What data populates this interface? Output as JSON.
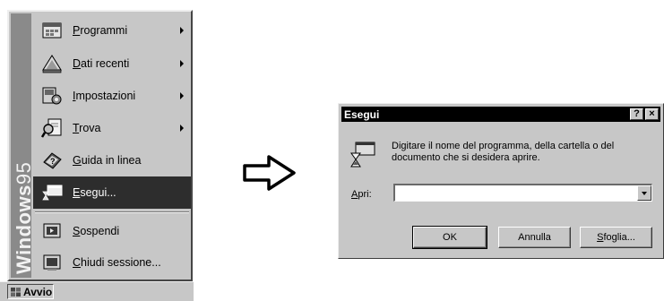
{
  "start_menu": {
    "brand": {
      "bold": "Windows",
      "light": "95"
    },
    "items": [
      {
        "label": "Programmi",
        "accel": "P",
        "rest": "rogrammi",
        "submenu": true,
        "icon": "programs-icon"
      },
      {
        "label": "Dati recenti",
        "accel": "D",
        "rest": "ati recenti",
        "submenu": true,
        "icon": "documents-icon"
      },
      {
        "label": "Impostazioni",
        "accel": "I",
        "rest": "mpostazioni",
        "submenu": true,
        "icon": "settings-icon"
      },
      {
        "label": "Trova",
        "accel": "T",
        "rest": "rova",
        "submenu": true,
        "icon": "find-icon"
      },
      {
        "label": "Guida in linea",
        "accel": "G",
        "rest": "uida in linea",
        "submenu": false,
        "icon": "help-icon"
      },
      {
        "label": "Esegui...",
        "accel": "E",
        "rest": "segui...",
        "submenu": false,
        "icon": "run-icon",
        "selected": true
      },
      {
        "label": "Sospendi",
        "accel": "S",
        "rest": "ospendi",
        "submenu": false,
        "icon": "suspend-icon"
      },
      {
        "label": "Chiudi sessione...",
        "accel": "C",
        "rest": "hiudi sessione...",
        "submenu": false,
        "icon": "shutdown-icon"
      }
    ]
  },
  "taskbar": {
    "start_label": "Avvio"
  },
  "dialog": {
    "title": "Esegui",
    "help_button": "?",
    "close_button": "×",
    "message": "Digitare il nome del programma, della cartella o del documento che si desidera aprire.",
    "open_label_accel": "A",
    "open_label_rest": "pri:",
    "open_value": "",
    "buttons": {
      "ok": "OK",
      "cancel": "Annulla",
      "browse_accel": "S",
      "browse_rest": "foglia..."
    }
  },
  "colors": {
    "face": "#c7c7c7",
    "highlight": "#2d2d2d",
    "brand_strip": "#8a8a8a"
  }
}
